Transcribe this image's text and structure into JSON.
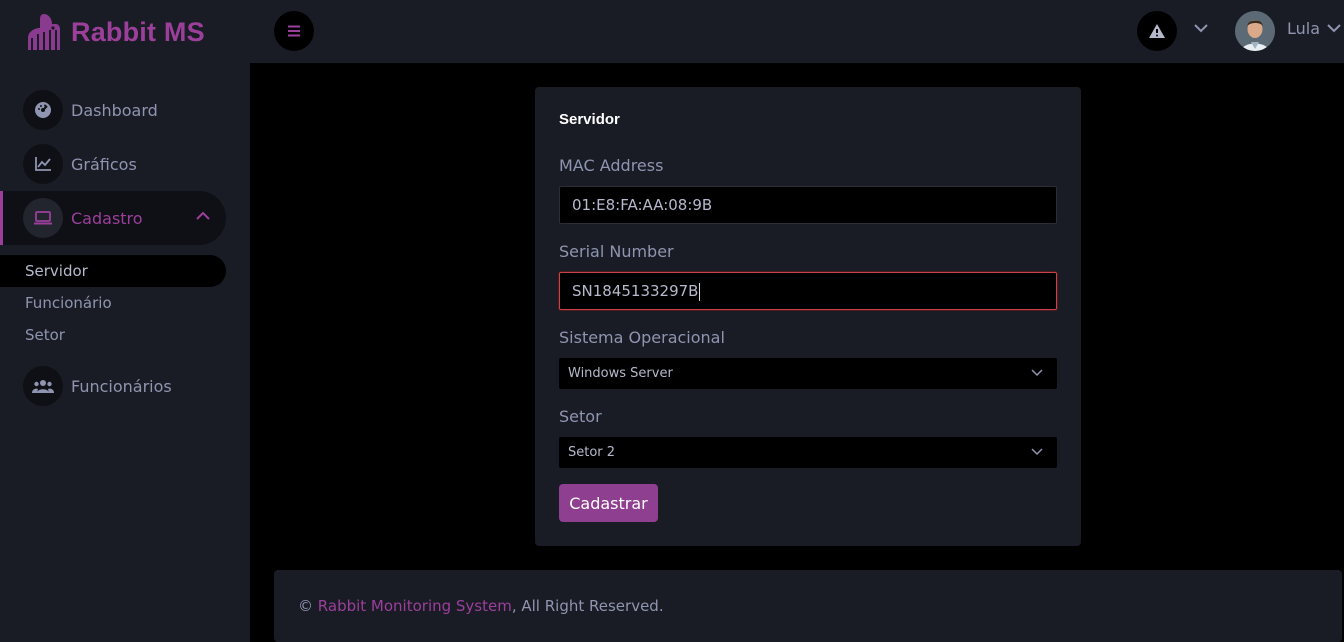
{
  "brand": {
    "name": "Rabbit MS"
  },
  "sidebar": {
    "items": [
      {
        "label": "Dashboard",
        "icon": "speedometer-icon"
      },
      {
        "label": "Gráficos",
        "icon": "chart-line-icon"
      },
      {
        "label": "Cadastro",
        "icon": "laptop-icon"
      },
      {
        "label": "Funcionários",
        "icon": "users-icon"
      }
    ],
    "submenu": [
      {
        "label": "Servidor"
      },
      {
        "label": "Funcionário"
      },
      {
        "label": "Setor"
      }
    ]
  },
  "topbar": {
    "user_name": "Lula"
  },
  "form": {
    "title": "Servidor",
    "mac_label": "MAC Address",
    "mac_value": "01:E8:FA:AA:08:9B",
    "serial_label": "Serial Number",
    "serial_value": "SN1845133297B",
    "os_label": "Sistema Operacional",
    "os_value": "Windows Server",
    "sector_label": "Setor",
    "sector_value": "Setor 2",
    "submit_label": "Cadastrar"
  },
  "footer": {
    "prefix": "© ",
    "link": "Rabbit Monitoring System",
    "suffix": ", All Right Reserved."
  },
  "colors": {
    "accent": "#9b3f9b",
    "sidebar_bg": "#191C24",
    "content_bg": "#000000",
    "focus_border": "#c9434b"
  }
}
